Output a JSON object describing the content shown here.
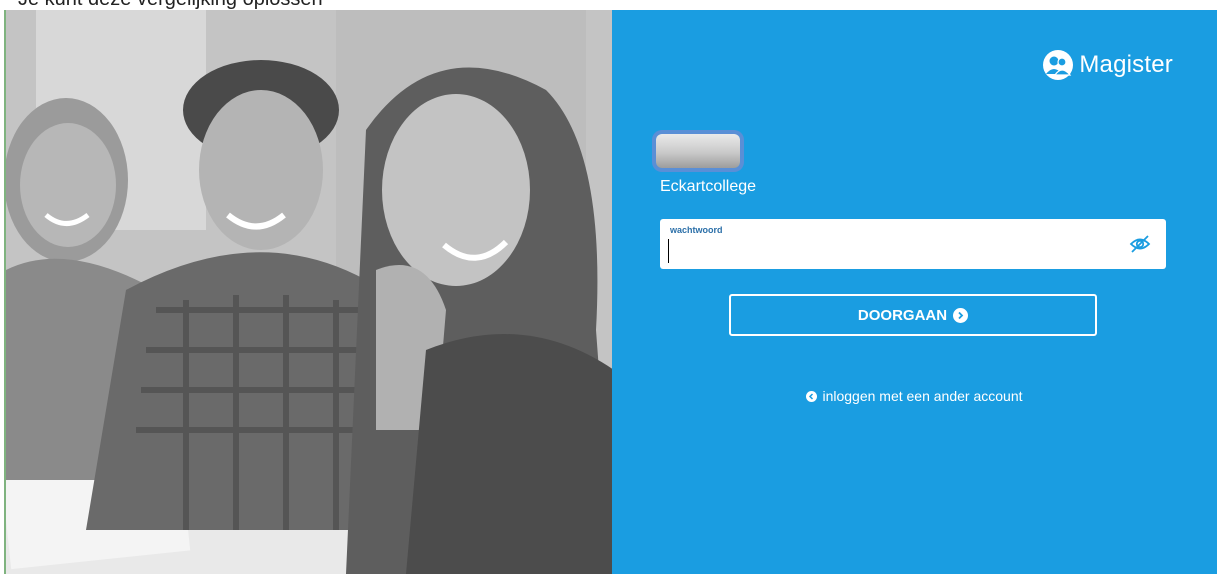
{
  "top_strip": {
    "clipped_text": "Je kunt deze vergelijking oplossen"
  },
  "brand": {
    "name": "Magister",
    "icon": "people-icon"
  },
  "school": {
    "name": "Eckartcollege"
  },
  "password": {
    "label": "wachtwoord",
    "value": "",
    "toggle_icon": "eye-slash-icon"
  },
  "continue_button": {
    "label": "DOORGAAN",
    "icon": "circle-arrow-right-icon"
  },
  "other_account": {
    "label": "inloggen met een ander account",
    "icon": "circle-arrow-left-icon"
  },
  "colors": {
    "panel": "#1a9de1",
    "text_on_panel": "#ffffff",
    "label_blue": "#2b6fa8"
  }
}
